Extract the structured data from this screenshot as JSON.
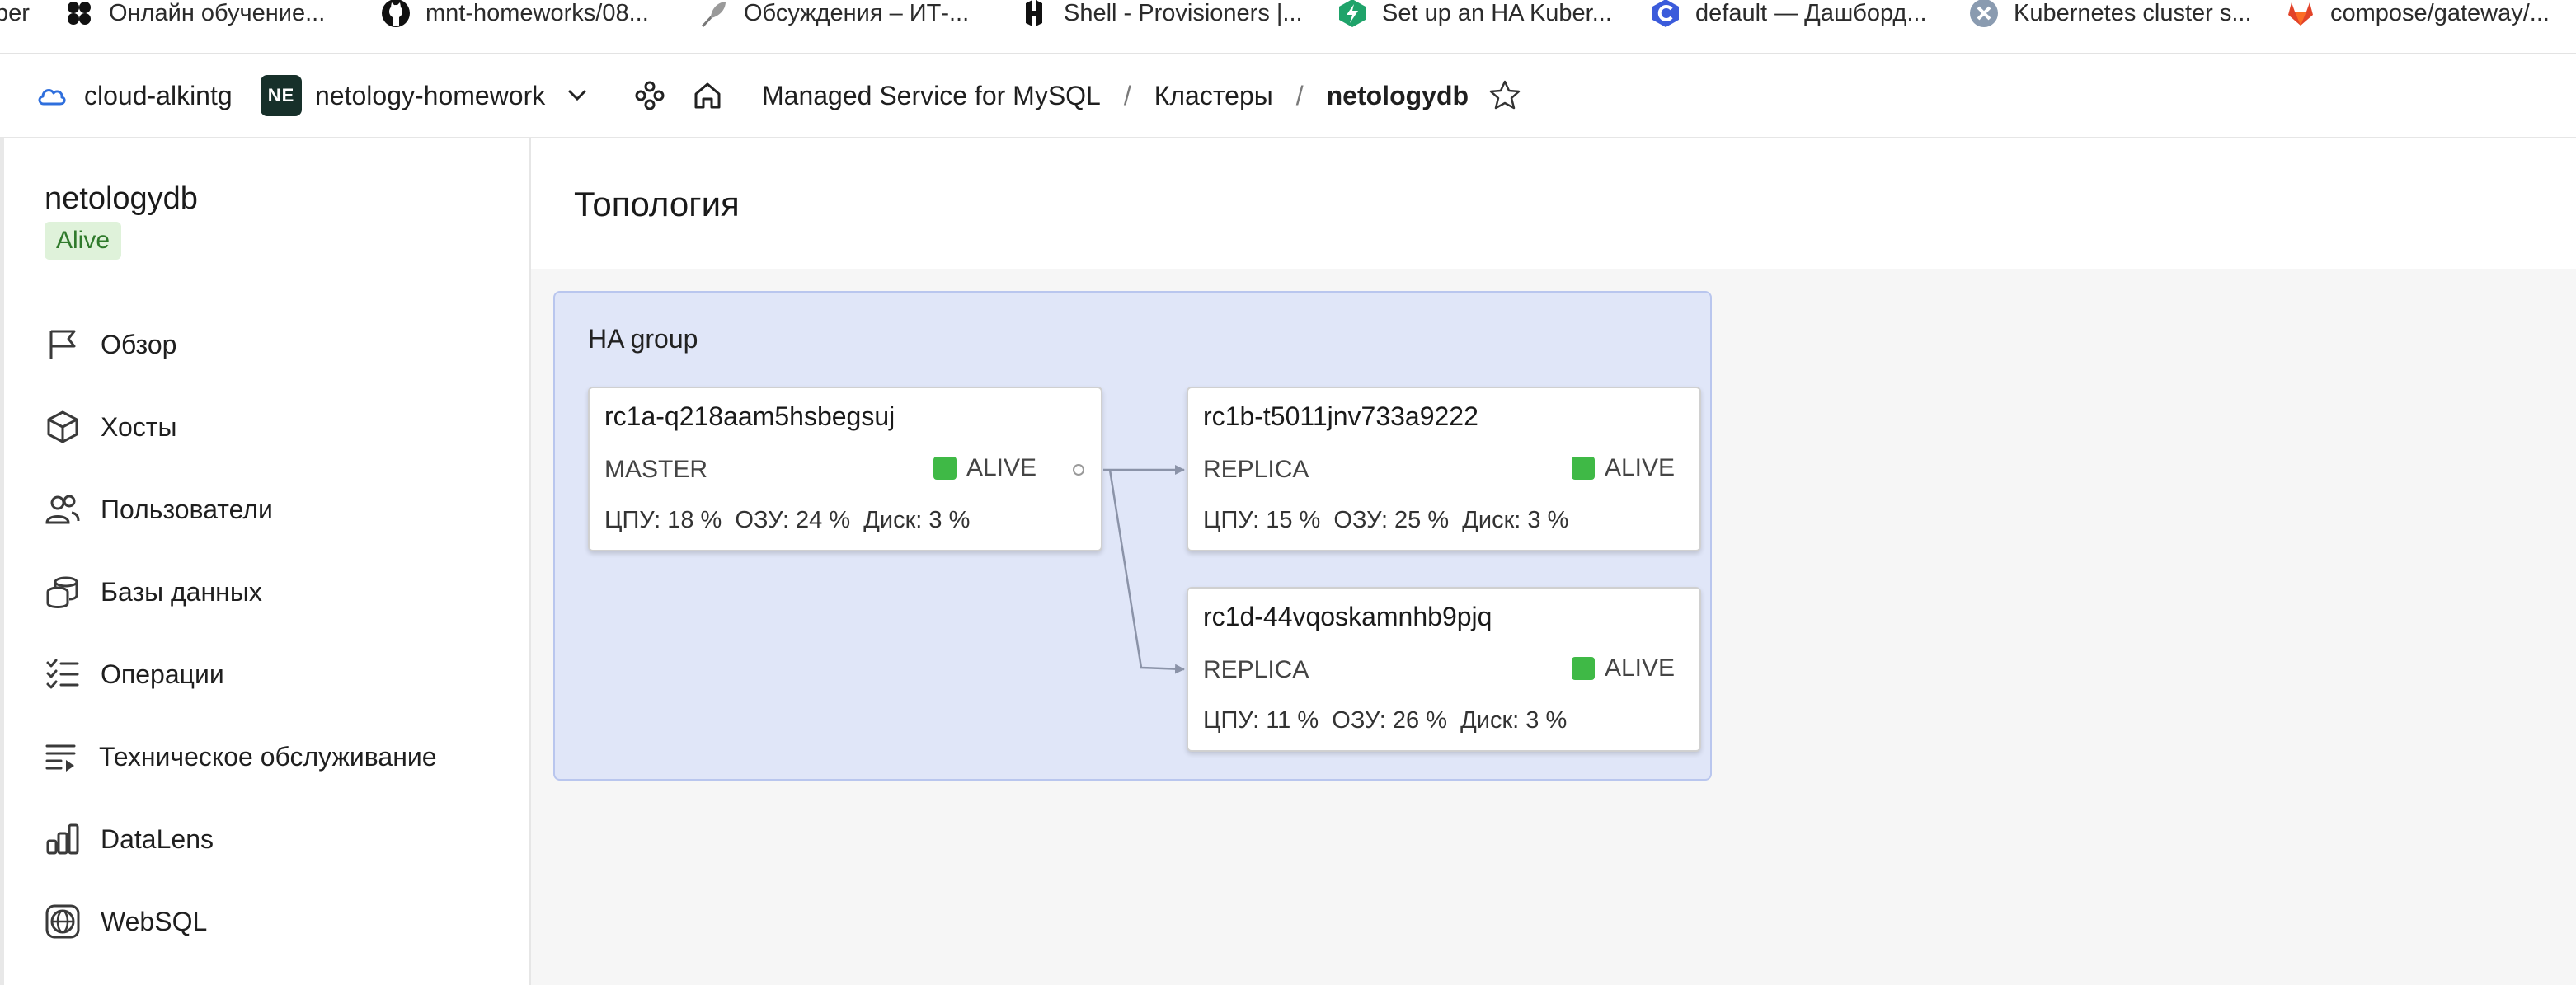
{
  "bookmarks": [
    {
      "label": "per",
      "icon": "none"
    },
    {
      "label": "Онлайн обучение...",
      "icon": "flower-icon"
    },
    {
      "label": "mnt-homeworks/08...",
      "icon": "github-icon"
    },
    {
      "label": "Обсуждения – ИТ-...",
      "icon": "feather-icon"
    },
    {
      "label": "Shell - Provisioners |...",
      "icon": "hashicorp-icon"
    },
    {
      "label": "Set up an HA Kuber...",
      "icon": "kube-bolt-icon"
    },
    {
      "label": "default — Дашборд...",
      "icon": "c-logo-icon"
    },
    {
      "label": "Kubernetes cluster s...",
      "icon": "kube-x-icon"
    },
    {
      "label": "compose/gateway/...",
      "icon": "gitlab-icon"
    }
  ],
  "header": {
    "cloud": "cloud-alkintg",
    "folder_badge": "NE",
    "folder": "netology-homework",
    "breadcrumbs": [
      "Managed Service for MySQL",
      "Кластеры",
      "netologydb"
    ],
    "separator": "/"
  },
  "sidebar": {
    "cluster_name": "netologydb",
    "status": "Alive",
    "items": [
      {
        "label": "Обзор",
        "icon": "flag-icon"
      },
      {
        "label": "Хосты",
        "icon": "cube-icon"
      },
      {
        "label": "Пользователи",
        "icon": "users-icon"
      },
      {
        "label": "Базы данных",
        "icon": "databases-icon"
      },
      {
        "label": "Операции",
        "icon": "checklist-icon"
      },
      {
        "label": "Техническое обслуживание",
        "icon": "maintenance-list-icon"
      },
      {
        "label": "DataLens",
        "icon": "bar-chart-icon"
      },
      {
        "label": "WebSQL",
        "icon": "globe-icon"
      }
    ]
  },
  "main": {
    "title": "Топология",
    "group_label": "HA group",
    "hosts": [
      {
        "name": "rc1a-q218aam5hsbegsuj",
        "role": "MASTER",
        "status": "ALIVE",
        "metrics": "ЦПУ: 18 %  ОЗУ: 24 %  Диск: 3 %"
      },
      {
        "name": "rc1b-t5011jnv733a9222",
        "role": "REPLICA",
        "status": "ALIVE",
        "metrics": "ЦПУ: 15 %  ОЗУ: 25 %  Диск: 3 %"
      },
      {
        "name": "rc1d-44vqoskamnhb9pjq",
        "role": "REPLICA",
        "status": "ALIVE",
        "metrics": "ЦПУ: 11 %  ОЗУ: 26 %  Диск: 3 %"
      }
    ]
  },
  "colors": {
    "alive": "#3fb946",
    "group_bg": "#e0e6f8",
    "badge_bg": "#dff2da",
    "badge_text": "#2f7a2b"
  }
}
